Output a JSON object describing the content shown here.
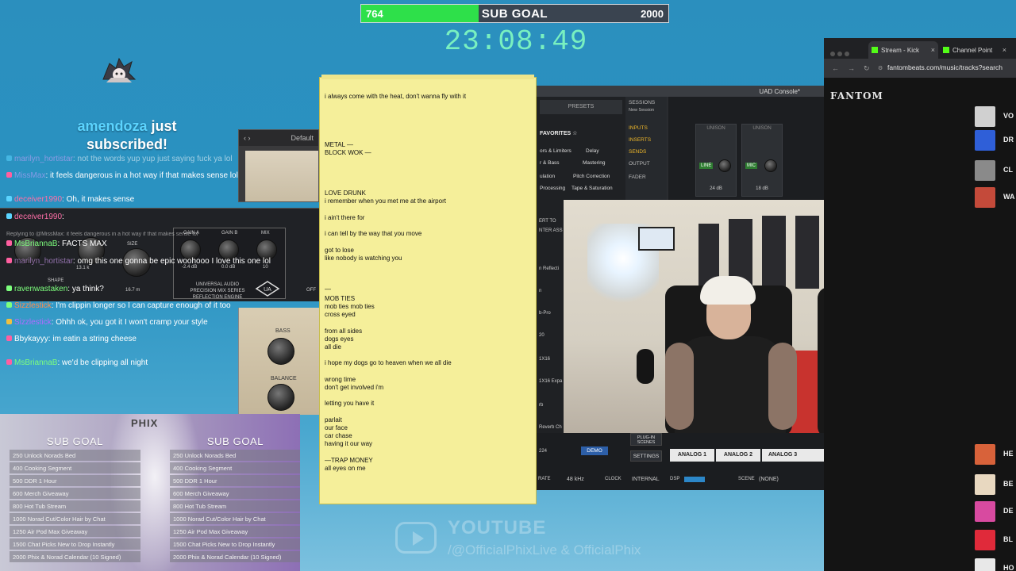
{
  "sub_goal": {
    "current": "764",
    "label": "SUB GOAL",
    "target": "2000",
    "progress_fraction": 0.382,
    "timer": "23:08:49"
  },
  "alert": {
    "username": "amendoza",
    "text_after_user": " just",
    "line2": "subscribed!"
  },
  "plugin": {
    "preset": "Default",
    "labels": {
      "gain_a": "GAIN A",
      "gain_b": "GAIN B",
      "mix": "MIX",
      "size": "SIZE",
      "shape": "SHAPE",
      "brand1": "UNIVERSAL AUDIO",
      "brand2": "PRECISION MIX SERIES",
      "brand3": "REFLECTION ENGINE",
      "val_gain_a": "-2.4 dB",
      "val_gain_b": "0.0 dB",
      "val_mix": "10",
      "val_size": "16.7 m",
      "val_predelay": "13.1 k",
      "bass": "BASS",
      "balance": "BALANCE",
      "off": "OFF"
    }
  },
  "chat": [
    {
      "user": "marilyn_hortistar",
      "msg": ": not the words yup yup just saying fuck ya lol",
      "color": "#d9a3ff"
    },
    {
      "user": "MissMax",
      "msg": ": it feels dangerous in a hot way if that makes sense lol",
      "color": "#bfa0ff"
    },
    {
      "user": "deceiver1990",
      "msg": ": Oh, it makes sense",
      "color": "#ff6fa8"
    },
    {
      "user": "deceiver1990",
      "msg": ":",
      "color": "#ff6fa8"
    },
    {
      "user": "",
      "msg": "Replying to @MissMax: it feels dangerous in a hot way if that makes sense lol",
      "color": "#ffffff"
    },
    {
      "user": "MsBriannaB",
      "msg": ": FACTS MAX",
      "color": "#7dff7d"
    },
    {
      "user": "marilyn_hortistar",
      "msg": ": omg this one gonna be epic woohooo I love this one lol",
      "color": "#d9a3ff"
    },
    {
      "user": "ravenwastaken",
      "msg": ": ya think?",
      "color": "#7dff7d"
    },
    {
      "user": "Sizzlestick",
      "msg": ": I'm clippin longer so I can capture enough of it too",
      "color": "#ff8c4d"
    },
    {
      "user": "Sizzlestick",
      "msg": ": Ohhh ok, you got it I won't cramp your style",
      "color": "#b06bff"
    },
    {
      "user": "Bbykayyy",
      "msg": ": im eatin a string cheese",
      "color": "#ffffff"
    },
    {
      "user": "MsBriannaB",
      "msg": ": we'd be clipping all night",
      "color": "#7dff7d"
    }
  ],
  "goals": {
    "title": "SUB GOAL",
    "logo": "PHIX",
    "items": [
      "250 Unlock Norads Bed",
      "400 Cooking Segment",
      "500 DDR 1 Hour",
      "600 Merch Giveaway",
      "800 Hot Tub Stream",
      "1000 Norad Cut/Color Hair by Chat",
      "1250 Air Pod Max Giveaway",
      "1500 Chat Picks New to Drop Instantly",
      "2000 Phix & Norad Calendar (10 Signed)"
    ]
  },
  "lyrics": [
    "i always come with the heat, don't wanna fly with it",
    "METAL —",
    "BLOCK WOK —",
    "LOVE DRUNK",
    "i remember when you met me at the airport",
    "i ain't there for",
    "i can tell by the way that you move",
    "got to lose",
    "like nobody is watching you",
    "—",
    "MOB TIES",
    "mob ties mob ties",
    "cross eyed",
    "from all sides",
    "dogs eyes",
    "all die",
    "i hope my dogs go to heaven when we all die",
    "wrong time",
    "don't get involved i'm",
    "letting you have it",
    "parlait",
    "our face",
    "car chase",
    "having it our way",
    "—TRAP MONEY",
    "all eyes on me"
  ],
  "uad": {
    "title": "UAD Console*",
    "presets": "PRESETS",
    "sessions": "SESSIONS",
    "new_session": "New Session",
    "favorites": "FAVORITES",
    "categories": [
      "Delay",
      "Mastering",
      "Pitch Correction",
      "Tape & Saturation"
    ],
    "left_categories": [
      "ors & Limiters",
      "r & Bass",
      "ulation",
      "Processing"
    ],
    "side": [
      "INPUTS",
      "INSERTS",
      "SENDS",
      "OUTPUT",
      "FADER"
    ],
    "ch1": {
      "label": "UNISON",
      "sw": "LINE",
      "db": "24 dB"
    },
    "ch2": {
      "label": "UNISON",
      "sw": "MIC",
      "db": "18 dB"
    },
    "lower_list": [
      "ERT TO",
      "NTER ASS",
      "n Reflecti",
      "n",
      "b-Pro",
      "20",
      "1X16",
      "1X16 Expa",
      "rb",
      "Reverb Ch",
      "224"
    ],
    "plugin_scenes": "PLUG-IN SCENES",
    "settings": "SETTINGS",
    "demo": "DEMO",
    "tabs": [
      "ANALOG 1",
      "ANALOG 2",
      "ANALOG 3"
    ],
    "rate": "RATE",
    "rate_val": "48 kHz",
    "clock": "CLOCK",
    "clock_val": "INTERNAL",
    "dsp": "DSP",
    "scene": "SCENE",
    "scene_val": "(NONE)"
  },
  "browser": {
    "tabs": [
      "Stream - Kick",
      "Channel Point"
    ],
    "url": "fantombeats.com/music/tracks?search",
    "brand": "FANTOM",
    "tracks_top": [
      {
        "name": "VO",
        "color": "#d0d0d0"
      },
      {
        "name": "DR",
        "color": "#2f5fd8"
      },
      {
        "name": "CL",
        "color": "#8a8a8a"
      },
      {
        "name": "WA",
        "color": "#c44a3a"
      }
    ],
    "tracks_bottom": [
      {
        "name": "HE",
        "color": "#d8623a"
      },
      {
        "name": "BE",
        "color": "#e8d8c0"
      },
      {
        "name": "DE",
        "color": "#d84aa0"
      },
      {
        "name": "BL",
        "color": "#e02a3a"
      },
      {
        "name": "HO",
        "color": "#e8e8e8"
      }
    ]
  },
  "youtube": {
    "title": "YOUTUBE",
    "handle": "/@OfficialPhixLive & OfficialPhix"
  }
}
